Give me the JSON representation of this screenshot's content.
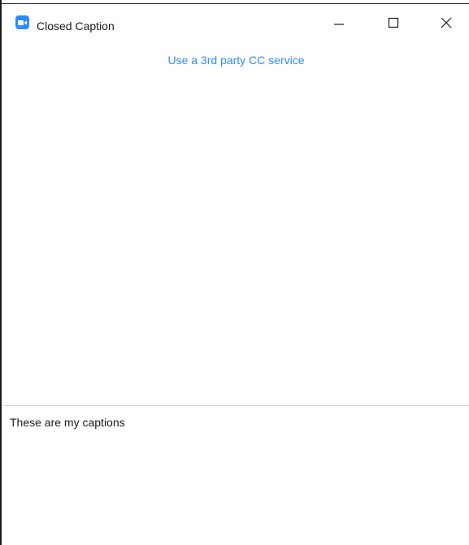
{
  "window": {
    "title": "Closed Caption",
    "app_icon": "zoom-camera-icon",
    "controls": [
      "minimize-icon",
      "maximize-icon",
      "close-icon"
    ]
  },
  "main": {
    "cc_link": "Use a 3rd party CC service"
  },
  "captions": {
    "text": "These are my captions"
  },
  "colors": {
    "accent": "#2d8cff",
    "text": "#1a1a1a",
    "divider": "#d0d0d0"
  }
}
